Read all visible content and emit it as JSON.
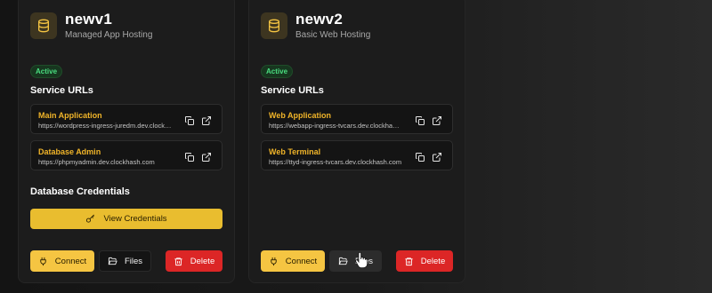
{
  "cards": [
    {
      "name": "newv1",
      "subtitle": "Managed App Hosting",
      "status": "Active",
      "service_urls_title": "Service URLs",
      "urls": [
        {
          "label": "Main Application",
          "url": "https://wordpress-ingress-juredm.dev.clockhash.com"
        },
        {
          "label": "Database Admin",
          "url": "https://phpmyadmin.dev.clockhash.com"
        }
      ],
      "credentials_title": "Database Credentials",
      "view_credentials_label": "View Credentials",
      "actions": {
        "connect": "Connect",
        "files": "Files",
        "delete": "Delete"
      }
    },
    {
      "name": "newv2",
      "subtitle": "Basic Web Hosting",
      "status": "Active",
      "service_urls_title": "Service URLs",
      "urls": [
        {
          "label": "Web Application",
          "url": "https://webapp-ingress-tvcars.dev.clockhash.com"
        },
        {
          "label": "Web Terminal",
          "url": "https://ttyd-ingress-tvcars.dev.clockhash.com"
        }
      ],
      "actions": {
        "connect": "Connect",
        "files": "Files",
        "delete": "Delete"
      }
    }
  ],
  "colors": {
    "accent": "#f5c542",
    "active_badge": "#4ade80",
    "danger": "#dc2626",
    "url_label": "#f0b429"
  },
  "icons": {
    "service": "database-icon",
    "copy": "copy-icon",
    "open": "external-link-icon",
    "credentials": "key-icon",
    "connect": "plug-icon",
    "files": "folder-open-icon",
    "delete": "trash-icon"
  }
}
